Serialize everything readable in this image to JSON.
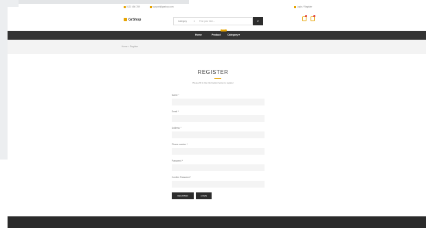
{
  "topbar": {
    "phone": "0123 456 789",
    "email": "support@grshop.com",
    "login": "Login / Register"
  },
  "header": {
    "brand": "GrShop",
    "search": {
      "category": "Category",
      "placeholder": "Find your item..."
    }
  },
  "nav": {
    "items": [
      "Home",
      "Product",
      "Category"
    ],
    "badge": "HOT"
  },
  "breadcrumb": "Home > Register",
  "register": {
    "title": "REGISTER",
    "subtitle": "Please fill in the information below to register",
    "fields": [
      {
        "label": "Name *"
      },
      {
        "label": "Email *"
      },
      {
        "label": "Address *"
      },
      {
        "label": "Phone number *"
      },
      {
        "label": "Password *"
      },
      {
        "label": "Confirm Password *"
      }
    ],
    "buttons": {
      "register": "REGISTER",
      "login": "LOGIN"
    }
  },
  "colors": {
    "accent": "#e6a300",
    "dark": "#333333",
    "footer": "#2b2b2b"
  }
}
